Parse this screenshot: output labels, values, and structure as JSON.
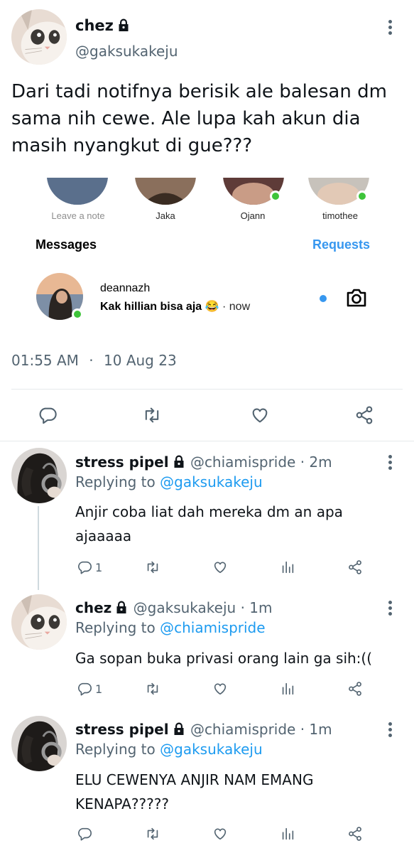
{
  "main_tweet": {
    "name": "chez",
    "handle": "@gaksukakeju",
    "text": "Dari tadi notifnya berisik ale balesan dm sama nih cewe. Ale lupa kah akun dia masih nyangkut di gue???",
    "time": "01:55 AM",
    "separator": "·",
    "date": "10 Aug 23"
  },
  "embed": {
    "notes": [
      "Leave a note",
      "Jaka",
      "Ojann",
      "timothee"
    ],
    "messages_label": "Messages",
    "requests_label": "Requests",
    "dm": {
      "user": "deannazh",
      "text": "Kak hillian bisa aja",
      "emoji": "😂",
      "separator": "·",
      "time": "now"
    },
    "accent": "#3797ef"
  },
  "replies": [
    {
      "name": "stress pipel",
      "handle": "@chiamispride",
      "age": "· 2m",
      "replying_prefix": "Replying to",
      "replying_to": "@gaksukakeju",
      "text": "Anjir coba liat dah mereka dm an apa ajaaaaa",
      "reply_count": "1"
    },
    {
      "name": "chez",
      "handle": "@gaksukakeju",
      "age": "· 1m",
      "replying_prefix": "Replying to",
      "replying_to": "@chiamispride",
      "text": "Ga sopan buka privasi orang lain ga sih:((",
      "reply_count": "1"
    },
    {
      "name": "stress pipel",
      "handle": "@chiamispride",
      "age": "· 1m",
      "replying_prefix": "Replying to",
      "replying_to": "@gaksukakeju",
      "text": "ELU CEWENYA ANJIR NAM EMANG KENAPA?????",
      "reply_count": ""
    }
  ],
  "colors": {
    "link": "#1d9bf0",
    "secondary": "#536471",
    "online": "#3ec43a"
  }
}
